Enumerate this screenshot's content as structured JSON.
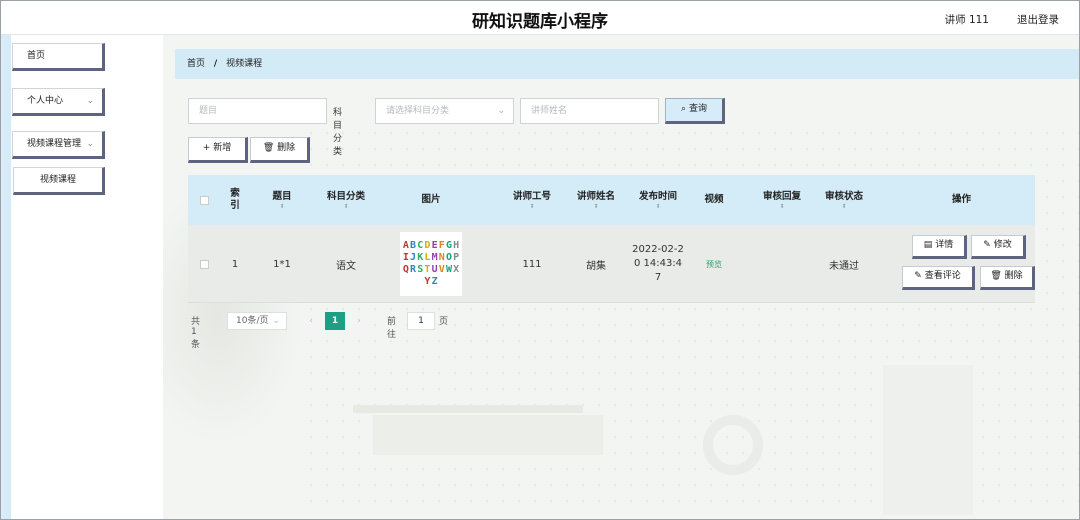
{
  "header": {
    "title": "研知识题库小程序",
    "user": "讲师 111",
    "logout": "退出登录"
  },
  "sidebar": {
    "items": [
      {
        "label": "首页"
      },
      {
        "label": "个人中心"
      },
      {
        "label": "视频课程管理"
      }
    ],
    "sub_items": [
      {
        "label": "视频课程"
      }
    ]
  },
  "breadcrumb": {
    "home": "首页",
    "separator": "/",
    "current": "视频课程"
  },
  "search": {
    "title_placeholder": "题目",
    "category_label": "科目分类",
    "category_placeholder": "请选择科目分类",
    "teacher_placeholder": "讲师姓名",
    "query_button": "查询"
  },
  "actions": {
    "add": "新增",
    "delete": "删除"
  },
  "table": {
    "headers": [
      "索引",
      "题目",
      "科目分类",
      "图片",
      "讲师工号",
      "讲师姓名",
      "发布时间",
      "视频",
      "审核回复",
      "审核状态",
      "操作"
    ],
    "rows": [
      {
        "index": "1",
        "title": "1*1",
        "category": "语文",
        "image_letters": "ABCDEFGHIJKLMNOPQRSTUVWXYZ",
        "teacher_id": "111",
        "teacher_name": "胡集",
        "publish_time": "2022-02-20 14:43:47",
        "video": "预览",
        "review_reply": "",
        "review_status": "未通过",
        "ops": {
          "detail": "详情",
          "edit": "修改",
          "comments": "查看评论",
          "delete": "删除"
        }
      }
    ]
  },
  "pagination": {
    "total": "共 1 条",
    "page_size": "10条/页",
    "current_page": "1",
    "goto_label": "前往",
    "goto_value": "1",
    "page_suffix": "页"
  },
  "colors": {
    "header_blue": "#d4ecf8",
    "accent_green": "#1e9e85",
    "button_shadow": "#5e6480"
  }
}
